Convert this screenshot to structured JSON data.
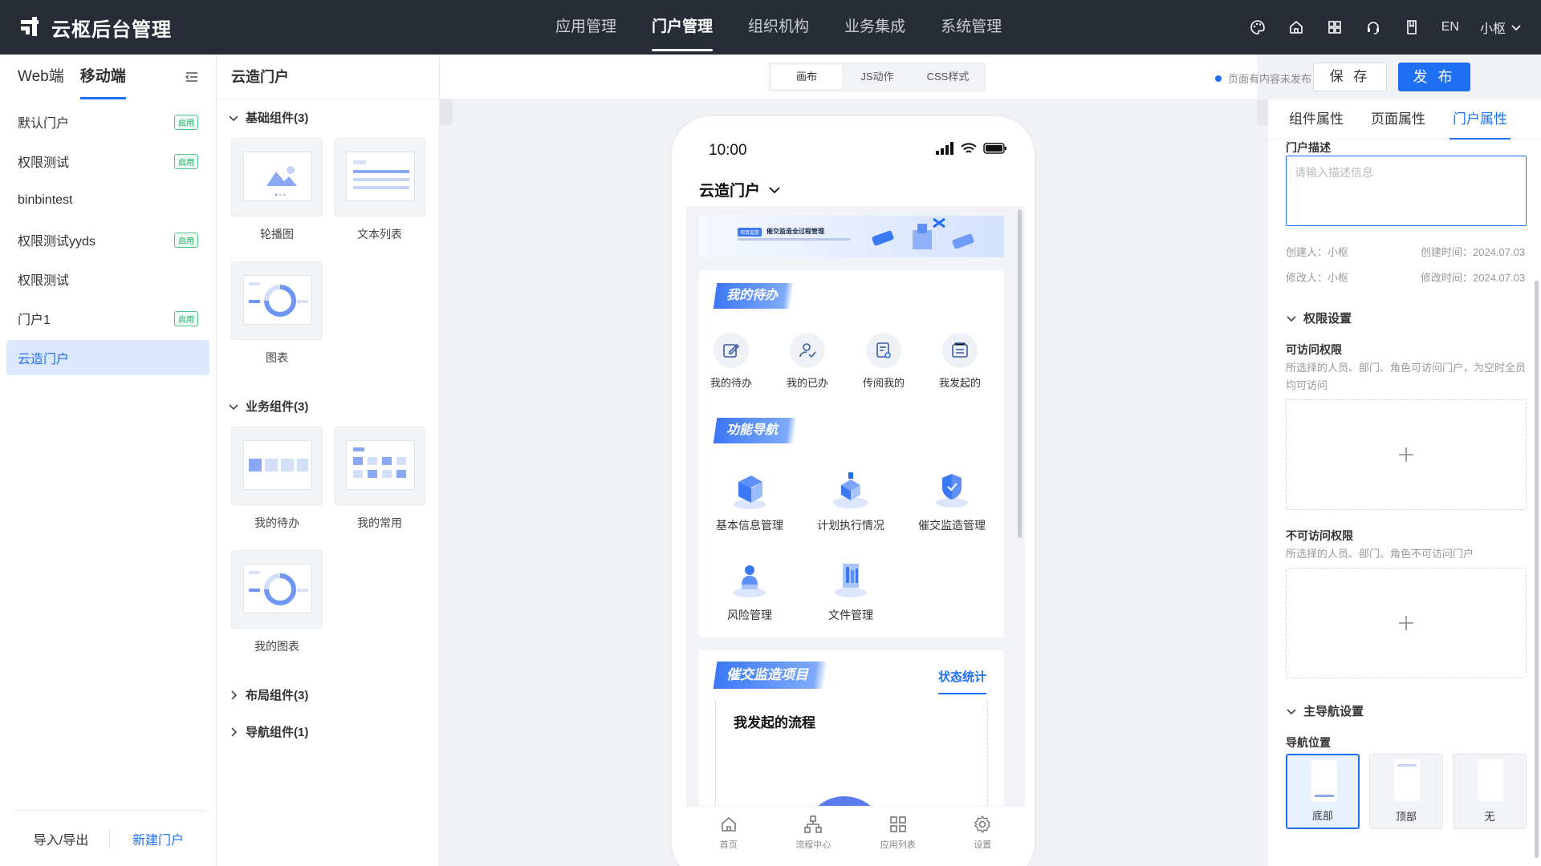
{
  "app": {
    "title": "云枢后台管理"
  },
  "topnav": {
    "items": [
      "应用管理",
      "门户管理",
      "组织机构",
      "业务集成",
      "系统管理"
    ],
    "active_index": 1,
    "lang": "EN",
    "user": "小枢"
  },
  "sidebar": {
    "tabs": [
      "Web端",
      "移动端"
    ],
    "active_tab": 1,
    "portals": [
      {
        "name": "默认门户",
        "badge": "启用"
      },
      {
        "name": "权限测试",
        "badge": "启用"
      },
      {
        "name": "binbintest",
        "badge": ""
      },
      {
        "name": "权限测试yyds",
        "badge": "启用"
      },
      {
        "name": "权限测试",
        "badge": ""
      },
      {
        "name": "门户1",
        "badge": "启用"
      },
      {
        "name": "云造门户",
        "badge": ""
      }
    ],
    "active_portal": 6,
    "footer": {
      "import_export": "导入/导出",
      "new_portal": "新建门户"
    }
  },
  "components": {
    "header": "云造门户",
    "groups": [
      {
        "title": "基础组件(3)",
        "expanded": true,
        "items": [
          "轮播图",
          "文本列表",
          "图表"
        ]
      },
      {
        "title": "业务组件(3)",
        "expanded": true,
        "items": [
          "我的待办",
          "我的常用",
          "我的图表"
        ]
      },
      {
        "title": "布局组件(3)",
        "expanded": false,
        "items": []
      },
      {
        "title": "导航组件(1)",
        "expanded": false,
        "items": []
      }
    ]
  },
  "toolbar": {
    "modes": [
      "画布",
      "JS动作",
      "CSS样式"
    ],
    "active_mode": 0,
    "status": "页面有内容未发布",
    "save": "保 存",
    "publish": "发 布"
  },
  "phone": {
    "time": "10:00",
    "portal_title": "云造门户",
    "banner_tag": "项目监督",
    "banner_text": "催交监造全过程管理",
    "todo": {
      "title": "我的待办",
      "items": [
        {
          "label": "我的待办",
          "icon": "edit-icon"
        },
        {
          "label": "我的已办",
          "icon": "user-check-icon"
        },
        {
          "label": "传阅我的",
          "icon": "document-view-icon"
        },
        {
          "label": "我发起的",
          "icon": "wallet-icon"
        }
      ]
    },
    "nav": {
      "title": "功能导航",
      "items": [
        "基本信息管理",
        "计划执行情况",
        "催交监造管理",
        "风险管理",
        "文件管理"
      ]
    },
    "project": {
      "title": "催交监造项目",
      "link": "状态统计",
      "subtitle": "我发起的流程"
    },
    "tabbar": [
      "首页",
      "流程中心",
      "应用列表",
      "设置"
    ]
  },
  "rpanel": {
    "tabs": [
      "组件属性",
      "页面属性",
      "门户属性"
    ],
    "active_tab": 2,
    "desc_label": "门户描述",
    "desc_placeholder": "请输入描述信息",
    "creator": "创建人：小枢",
    "created": "创建时间：2024.07.03",
    "modifier": "修改人：小枢",
    "modified": "修改时间：2024.07.03",
    "perm_section": "权限设置",
    "allow_label": "可访问权限",
    "allow_desc": "所选择的人员、部门、角色可访问门户，为空时全员均可访问",
    "deny_label": "不可访问权限",
    "deny_desc": "所选择的人员、部门、角色不可访问门户",
    "nav_section": "主导航设置",
    "navpos_label": "导航位置",
    "navpos": [
      "底部",
      "顶部",
      "无"
    ],
    "navpos_active": 0
  },
  "colors": {
    "accent": "#1f6ff2",
    "topbar": "#272c36",
    "success": "#1db36b"
  }
}
